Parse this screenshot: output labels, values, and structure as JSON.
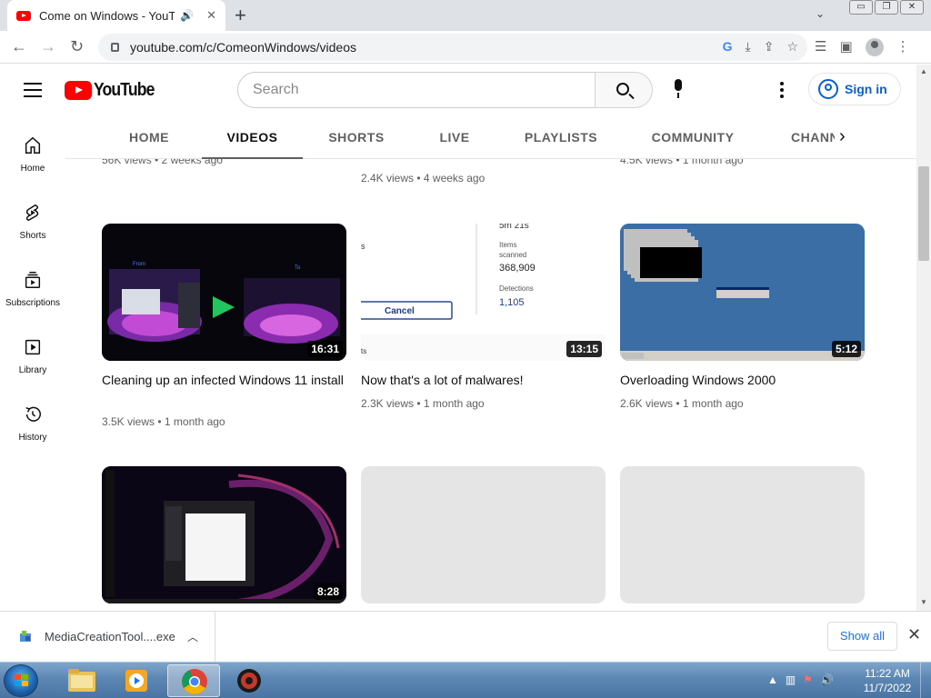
{
  "browser": {
    "tab_title": "Come on Windows - YouTube",
    "tab_audio_icon": "speaker-icon",
    "tab_close": "✕",
    "new_tab": "+",
    "url": "youtube.com/c/ComeonWindows/videos",
    "window_controls": [
      "▭",
      "❐",
      "✕"
    ]
  },
  "youtube": {
    "logo_text": "YouTube",
    "search_placeholder": "Search",
    "signin_label": "Sign in",
    "guide": [
      {
        "label": "Home",
        "icon": "home-icon"
      },
      {
        "label": "Shorts",
        "icon": "shorts-icon"
      },
      {
        "label": "Subscriptions",
        "icon": "subscriptions-icon"
      },
      {
        "label": "Library",
        "icon": "library-icon"
      },
      {
        "label": "History",
        "icon": "history-icon"
      }
    ],
    "channel_tabs": [
      "HOME",
      "VIDEOS",
      "SHORTS",
      "LIVE",
      "PLAYLISTS",
      "COMMUNITY",
      "CHANNELS"
    ],
    "active_tab": "VIDEOS",
    "partial_row_meta": [
      "56K views • 2 weeks ago",
      "2.4K views • 4 weeks ago",
      "4.5K views • 1 month ago"
    ],
    "videos": [
      {
        "title": "Cleaning up an infected Windows 11 install",
        "meta": "3.5K views • 1 month ago",
        "duration": "16:31"
      },
      {
        "title": "Now that's a lot of malwares!",
        "meta": "2.3K views • 1 month ago",
        "duration": "13:15"
      },
      {
        "title": "Overloading Windows 2000",
        "meta": "2.6K views • 1 month ago",
        "duration": "5:12"
      },
      {
        "title": "",
        "meta": "",
        "duration": "8:28"
      }
    ],
    "thumb2_text": {
      "time": "5m 21s",
      "items_label": "Items",
      "scanned_label": "scanned",
      "items_value": "368,909",
      "detections_label": "Detections",
      "detections_value": "1,105",
      "cancel": "Cancel",
      "left_frag_1": "s",
      "left_frag_2": "ts"
    },
    "thumb1_text": {
      "from": "From",
      "to": "To"
    }
  },
  "download_bar": {
    "file_name": "MediaCreationTool....exe",
    "show_all": "Show all"
  },
  "taskbar": {
    "time": "11:22 AM",
    "date": "11/7/2022"
  },
  "colors": {
    "yt_red": "#ff0000",
    "link_blue": "#065fd4",
    "chrome_tab_strip": "#dee1e6"
  }
}
